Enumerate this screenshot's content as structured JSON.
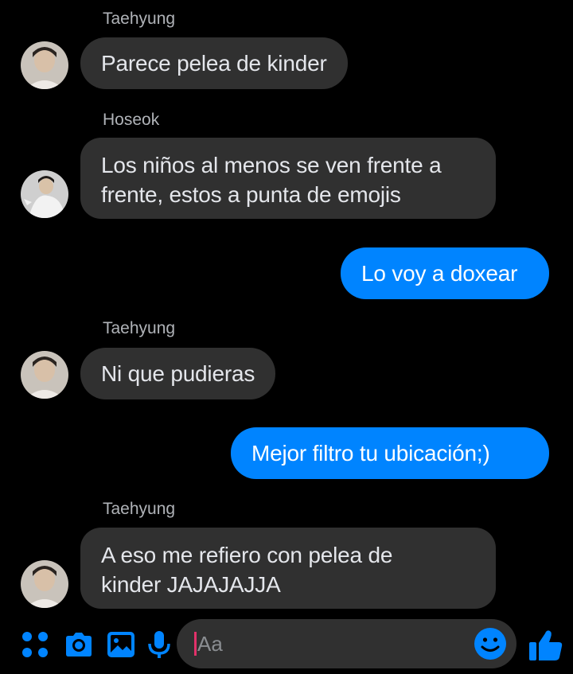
{
  "messages": [
    {
      "sender": "Taehyung",
      "text": "Parece pelea de kinder",
      "direction": "incoming"
    },
    {
      "sender": "Hoseok",
      "text_lines": [
        "Los niños al menos se ven frente a",
        "frente, estos a punta de emojis"
      ],
      "direction": "incoming"
    },
    {
      "text": "Lo voy a doxear",
      "direction": "outgoing"
    },
    {
      "sender": "Taehyung",
      "text": "Ni que pudieras",
      "direction": "incoming"
    },
    {
      "text": "Mejor filtro tu ubicación;)",
      "direction": "outgoing"
    },
    {
      "sender": "Taehyung",
      "text_lines": [
        "A eso me refiero con pelea de",
        "kinder JAJAJAJJA"
      ],
      "direction": "incoming"
    }
  ],
  "composer": {
    "placeholder": "Aa",
    "icons": [
      "apps-grid-icon",
      "camera-icon",
      "image-icon",
      "microphone-icon",
      "emoji-icon",
      "thumbs-up-icon"
    ]
  },
  "colors": {
    "background": "#000000",
    "incoming_bubble": "#303030",
    "outgoing_bubble": "#0084ff",
    "accent": "#0084ff",
    "caret": "#e2316a"
  }
}
